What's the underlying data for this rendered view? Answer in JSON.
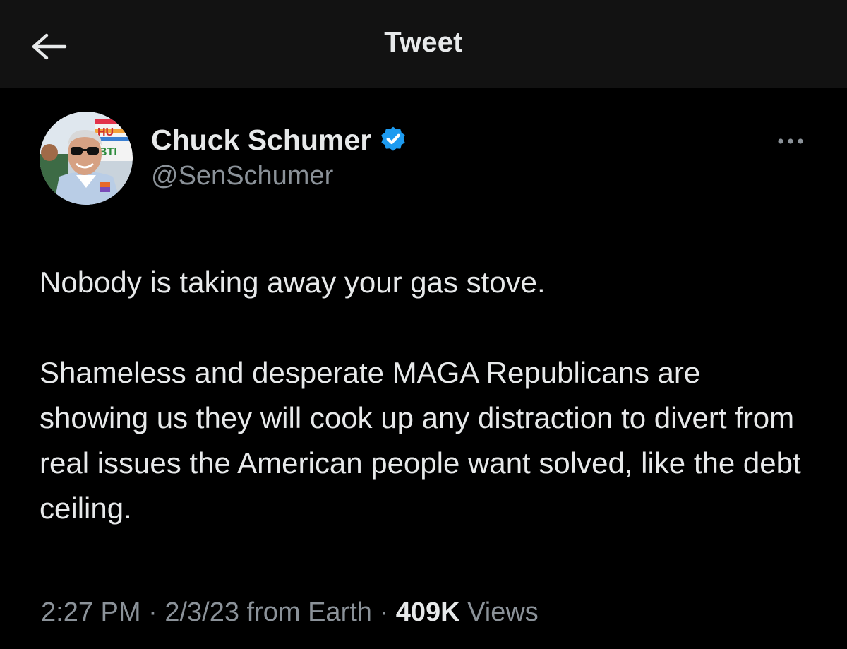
{
  "header": {
    "title": "Tweet",
    "back_icon": "arrow-left-icon"
  },
  "tweet": {
    "author": {
      "name": "Chuck Schumer",
      "handle": "@SenSchumer",
      "verified": true,
      "verified_color": "#1d9bf0",
      "avatar_sign_text": "HU BTI"
    },
    "more_icon": "more-horizontal-icon",
    "text": [
      "Nobody is taking away your gas stove.",
      "Shameless and desperate MAGA Republicans are showing us they will cook up any distraction to divert from real issues the American people want solved, like the debt ceiling."
    ],
    "meta": {
      "time": "2:27 PM",
      "separator": " · ",
      "date": "2/3/23",
      "source": "from Earth",
      "views_count": "409K",
      "views_label": "Views"
    }
  },
  "colors": {
    "background": "#000000",
    "header_background": "#121212",
    "primary_text": "#e7e9ea",
    "secondary_text": "#8b9299"
  }
}
